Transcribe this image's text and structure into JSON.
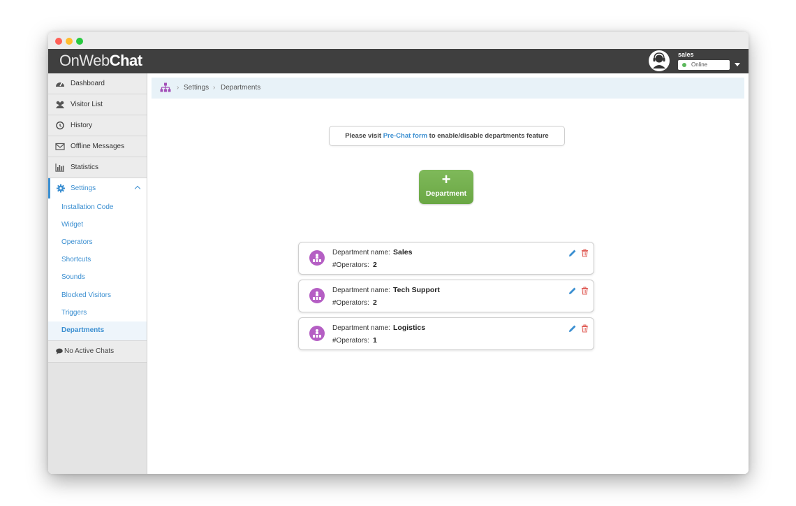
{
  "app": {
    "logo_prefix": "OnWeb",
    "logo_suffix": "Chat"
  },
  "user": {
    "name": "sales",
    "status": "Online",
    "status_color": "#5cb85c"
  },
  "sidebar": {
    "items": [
      {
        "label": "Dashboard",
        "icon": "dashboard-icon"
      },
      {
        "label": "Visitor List",
        "icon": "users-icon"
      },
      {
        "label": "History",
        "icon": "clock-icon"
      },
      {
        "label": "Offline Messages",
        "icon": "envelope-icon"
      },
      {
        "label": "Statistics",
        "icon": "bar-chart-icon"
      },
      {
        "label": "Settings",
        "icon": "gear-icon"
      }
    ],
    "submenu": [
      "Installation Code",
      "Widget",
      "Operators",
      "Shortcuts",
      "Sounds",
      "Blocked Visitors",
      "Triggers",
      "Departments"
    ],
    "active_submenu": "Departments",
    "no_chats": "No Active Chats"
  },
  "breadcrumb": {
    "icon": "sitemap-icon",
    "items": [
      "Settings",
      "Departments"
    ]
  },
  "notice": {
    "prefix": "Please visit",
    "link": "Pre-Chat form",
    "suffix": "to enable/disable departments feature"
  },
  "add_button": {
    "icon": "+",
    "label": "Department",
    "color": "#6aa744"
  },
  "departments": {
    "name_label": "Department name:",
    "ops_label": "#Operators:",
    "list": [
      {
        "name": "Sales",
        "operators": "2"
      },
      {
        "name": "Tech Support",
        "operators": "2"
      },
      {
        "name": "Logistics",
        "operators": "1"
      }
    ]
  },
  "colors": {
    "accent": "#3b8fd1",
    "topbar": "#3f3f3f",
    "department_icon": "#b55fc4",
    "delete": "#e0605a"
  }
}
